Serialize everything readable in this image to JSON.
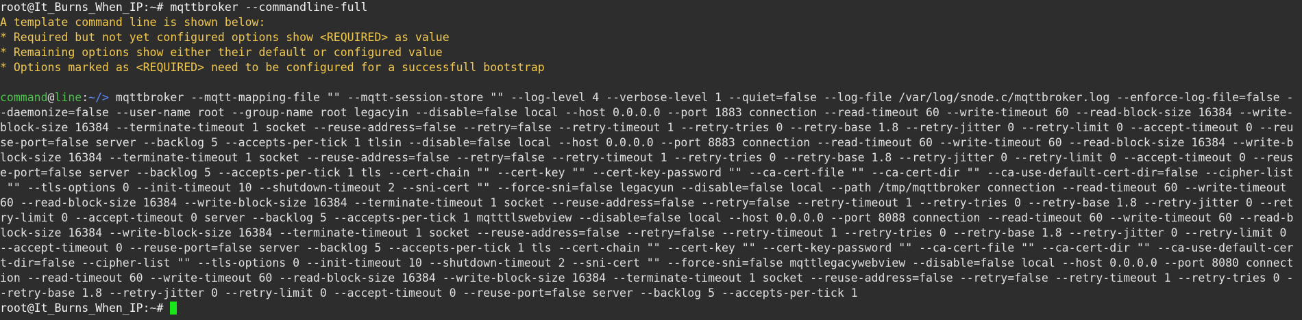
{
  "terminal": {
    "root_prompt": "root@It_Burns_When_IP:~#",
    "first_command": "mqttbroker --commandline-full",
    "output_lines": [
      "A template command line is shown below:",
      "* Required but not yet configured options show <REQUIRED> as value",
      "* Remaining options show either their default or configured value",
      "* Options marked as <REQUIRED> need to be configured for a successfull bootstrap"
    ],
    "template_prompt": {
      "user": "command",
      "at": "@",
      "host": "line",
      "sep": ":",
      "path": "~/>",
      "space": " "
    },
    "template_lines": [
      "mqttbroker --mqtt-mapping-file \"\" --mqtt-session-store \"\" --log-level 4 --verbose-level 1 --quiet=false --log-file /var/log/snode.c/mqttbroker.log --enforce-log-file=false -",
      "-daemonize=false --user-name root --group-name root legacyin --disable=false local --host 0.0.0.0 --port 1883 connection --read-timeout 60 --write-timeout 60 --read-block-size 16384 --write-",
      "block-size 16384 --terminate-timeout 1 socket --reuse-address=false --retry=false --retry-timeout 1 --retry-tries 0 --retry-base 1.8 --retry-jitter 0 --retry-limit 0 --accept-timeout 0 --reu",
      "se-port=false server --backlog 5 --accepts-per-tick 1 tlsin --disable=false local --host 0.0.0.0 --port 8883 connection --read-timeout 60 --write-timeout 60 --read-block-size 16384 --write-b",
      "lock-size 16384 --terminate-timeout 1 socket --reuse-address=false --retry=false --retry-timeout 1 --retry-tries 0 --retry-base 1.8 --retry-jitter 0 --retry-limit 0 --accept-timeout 0 --reus",
      "e-port=false server --backlog 5 --accepts-per-tick 1 tls --cert-chain \"\" --cert-key \"\" --cert-key-password \"\" --ca-cert-file \"\" --ca-cert-dir \"\" --ca-use-default-cert-dir=false --cipher-list",
      " \"\" --tls-options 0 --init-timeout 10 --shutdown-timeout 2 --sni-cert \"\" --force-sni=false legacyun --disable=false local --path /tmp/mqttbroker connection --read-timeout 60 --write-timeout",
      "60 --read-block-size 16384 --write-block-size 16384 --terminate-timeout 1 socket --reuse-address=false --retry=false --retry-timeout 1 --retry-tries 0 --retry-base 1.8 --retry-jitter 0 --ret",
      "ry-limit 0 --accept-timeout 0 server --backlog 5 --accepts-per-tick 1 mqtttlswebview --disable=false local --host 0.0.0.0 --port 8088 connection --read-timeout 60 --write-timeout 60 --read-b",
      "lock-size 16384 --write-block-size 16384 --terminate-timeout 1 socket --reuse-address=false --retry=false --retry-timeout 1 --retry-tries 0 --retry-base 1.8 --retry-jitter 0 --retry-limit 0",
      "--accept-timeout 0 --reuse-port=false server --backlog 5 --accepts-per-tick 1 tls --cert-chain \"\" --cert-key \"\" --cert-key-password \"\" --ca-cert-file \"\" --ca-cert-dir \"\" --ca-use-default-cer",
      "t-dir=false --cipher-list \"\" --tls-options 0 --init-timeout 10 --shutdown-timeout 2 --sni-cert \"\" --force-sni=false mqttlegacywebview --disable=false local --host 0.0.0.0 --port 8080 connect",
      "ion --read-timeout 60 --write-timeout 60 --read-block-size 16384 --write-block-size 16384 --terminate-timeout 1 socket --reuse-address=false --retry=false --retry-timeout 1 --retry-tries 0 -",
      "-retry-base 1.8 --retry-jitter 0 --retry-limit 0 --accept-timeout 0 --reuse-port=false server --backlog 5 --accepts-per-tick 1"
    ],
    "space": " ",
    "colors": {
      "background": "#2d2d2d",
      "output": "#f2c94c",
      "prompt_user_host": "#48c448",
      "prompt_path": "#5b8bff",
      "cursor": "#19e619"
    }
  }
}
